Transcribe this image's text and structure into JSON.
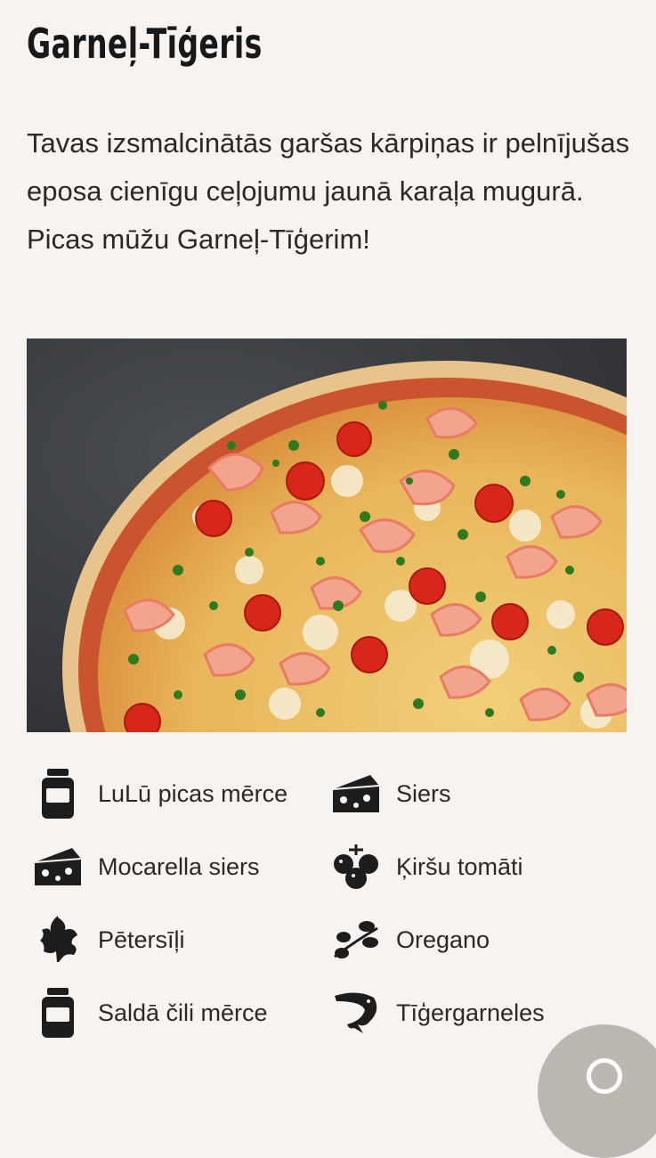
{
  "product": {
    "title": "Garneļ-Tīģeris",
    "description": "Tavas izsmalcinātās garšas kārpiņas ir pelnījušas eposa cienīgu ceļojumu jaunā karaļa mugurā. Picas mūžu Garneļ-Tīģerim!"
  },
  "ingredients": [
    {
      "label": "LuLū picas mērce",
      "icon": "sauce-jar-icon"
    },
    {
      "label": "Siers",
      "icon": "cheese-icon"
    },
    {
      "label": "Mocarella siers",
      "icon": "cheese-icon"
    },
    {
      "label": "Ķiršu tomāti",
      "icon": "cherry-tomatoes-icon"
    },
    {
      "label": "Pētersīļi",
      "icon": "parsley-icon"
    },
    {
      "label": "Oregano",
      "icon": "oregano-icon"
    },
    {
      "label": "Saldā čili mērce",
      "icon": "sauce-jar-icon"
    },
    {
      "label": "Tīģergarneles",
      "icon": "shrimp-icon"
    }
  ],
  "colors": {
    "background": "#f6f3f1",
    "text": "#2b2826",
    "fab": "#bdb7b1"
  }
}
